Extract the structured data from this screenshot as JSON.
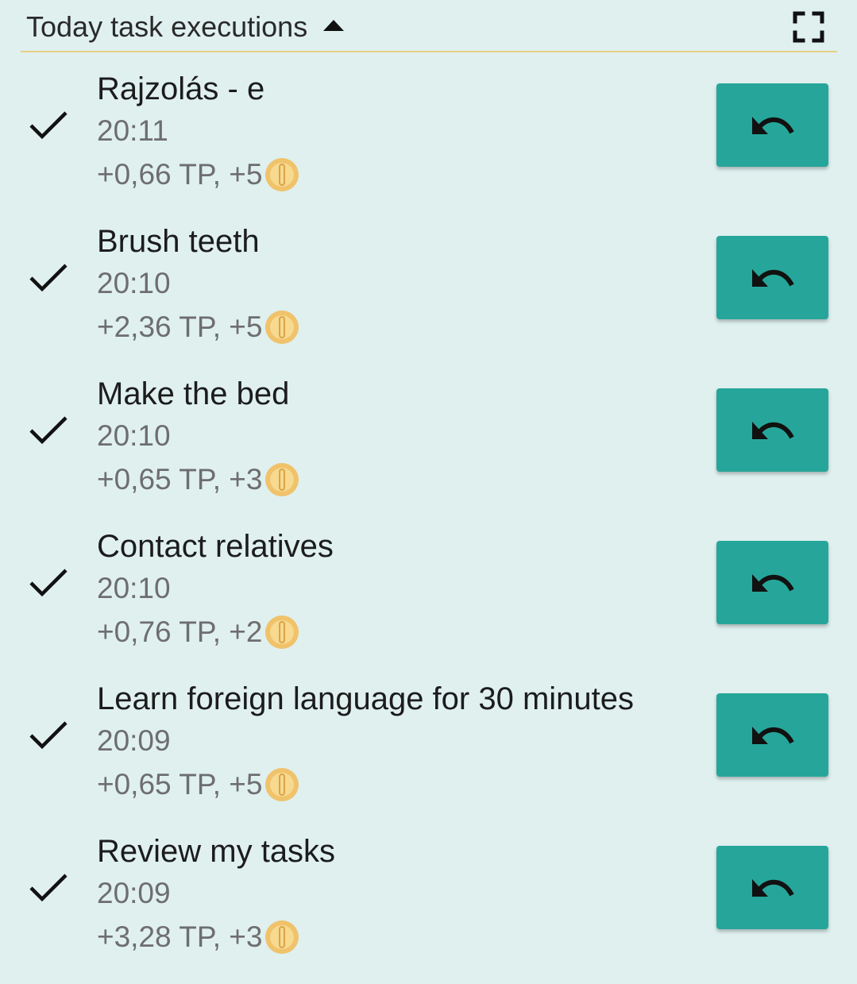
{
  "header": {
    "title": "Today task executions"
  },
  "tasks": [
    {
      "name": "Rajzolás - e",
      "time": "20:11",
      "reward": "+0,66 TP, +5"
    },
    {
      "name": "Brush teeth",
      "time": "20:10",
      "reward": "+2,36 TP, +5"
    },
    {
      "name": "Make the bed",
      "time": "20:10",
      "reward": "+0,65 TP, +3"
    },
    {
      "name": "Contact relatives",
      "time": "20:10",
      "reward": "+0,76 TP, +2"
    },
    {
      "name": "Learn foreign language for 30 minutes",
      "time": "20:09",
      "reward": "+0,65 TP, +5"
    },
    {
      "name": "Review my tasks",
      "time": "20:09",
      "reward": "+3,28 TP, +3"
    }
  ],
  "colors": {
    "background": "#dff0ef",
    "accent": "#26a69a",
    "divider": "#e8cf85",
    "coin": "#f0c26a"
  },
  "icons": {
    "header_toggle": "caret-up-icon",
    "fullscreen": "fullscreen-icon",
    "done": "check-icon",
    "undo": "undo-icon",
    "currency": "coin-icon"
  }
}
